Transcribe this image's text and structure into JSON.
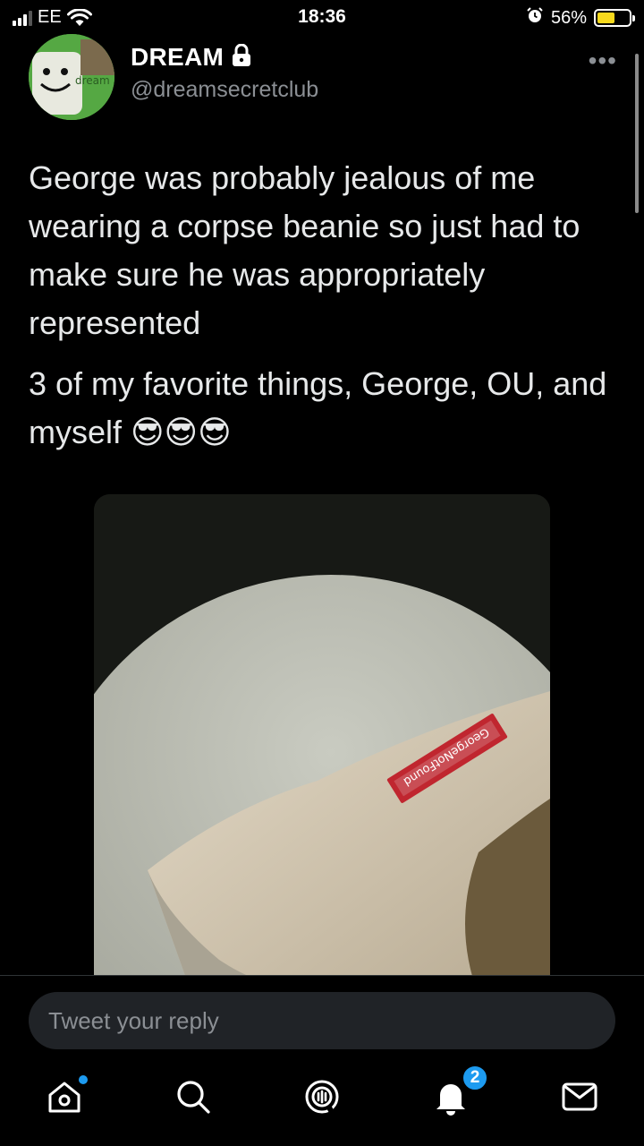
{
  "status_bar": {
    "carrier": "EE",
    "time": "18:36",
    "battery_percent": "56%",
    "battery_level": 0.56,
    "battery_color": "#f7d91c"
  },
  "tweet": {
    "author_name": "DREAM",
    "author_handle": "@dreamsecretclub",
    "avatar_text": "dream",
    "more_icon": "more-horizontal-icon",
    "paragraphs": [
      "George was probably jealous of me wearing a corpse beanie so just had to make sure he was appropriately represented",
      "3 of my favorite things, George, OU, and myself 😎😎😎"
    ],
    "media_label_text": "GeorgeNotFound"
  },
  "reply": {
    "placeholder": "Tweet your reply"
  },
  "bottom_nav": {
    "items": [
      {
        "icon": "home-icon"
      },
      {
        "icon": "search-icon"
      },
      {
        "icon": "spaces-icon"
      },
      {
        "icon": "notifications-icon",
        "badge": "2"
      },
      {
        "icon": "messages-icon"
      }
    ],
    "accent": "#1d9bf0"
  }
}
